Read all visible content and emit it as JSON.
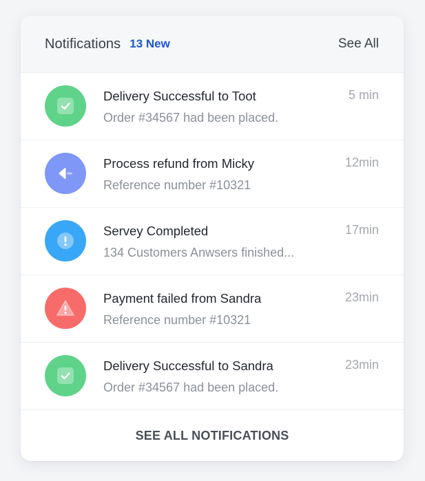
{
  "header": {
    "title": "Notifications",
    "new_count": "13 New",
    "see_all": "See All"
  },
  "notifications": [
    {
      "title": "Delivery Successful to Toot",
      "subtitle": "Order #34567 had been placed.",
      "time": "5 min",
      "icon": "check-icon",
      "color": "#5fd389"
    },
    {
      "title": "Process refund from Micky",
      "subtitle": "Reference number #10321",
      "time": "12min",
      "icon": "refund-icon",
      "color": "#7f97f7"
    },
    {
      "title": "Servey Completed",
      "subtitle": "134 Customers Anwsers finished...",
      "time": "17min",
      "icon": "info-icon",
      "color": "#39a7f8"
    },
    {
      "title": "Payment failed from Sandra",
      "subtitle": "Reference number #10321",
      "time": "23min",
      "icon": "warning-icon",
      "color": "#f86b6b"
    },
    {
      "title": "Delivery Successful to Sandra",
      "subtitle": "Order #34567 had been placed.",
      "time": "23min",
      "icon": "check-icon",
      "color": "#5fd389"
    }
  ],
  "footer": {
    "label": "SEE ALL NOTIFICATIONS"
  }
}
